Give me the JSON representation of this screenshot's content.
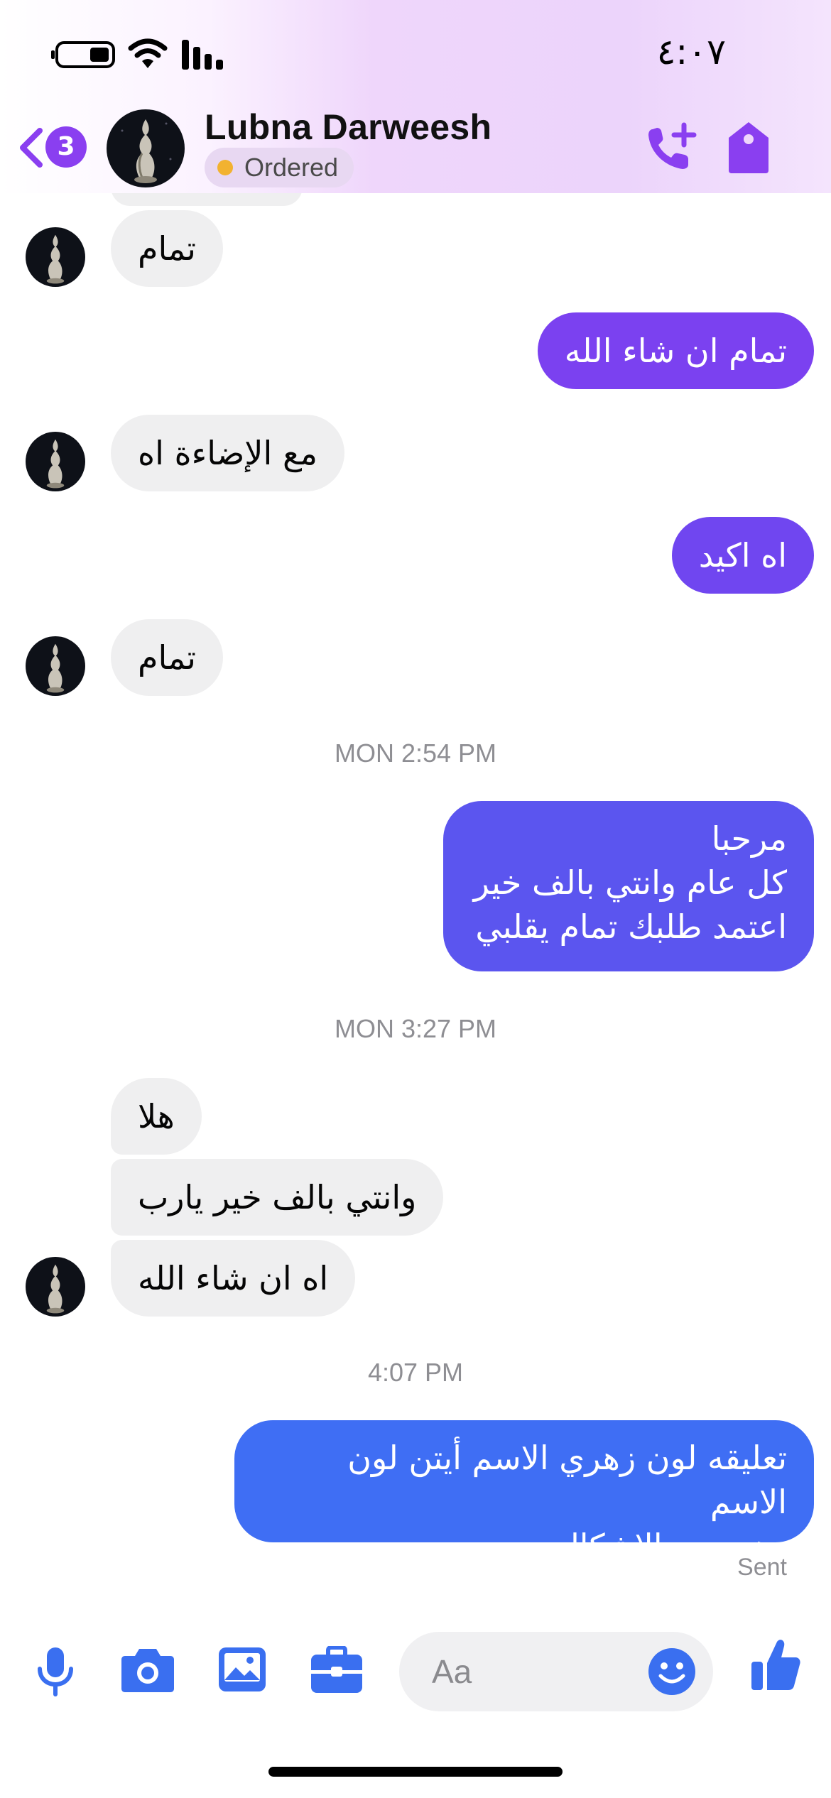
{
  "status_bar": {
    "time": "٤:٠٧",
    "icons": [
      "battery-icon",
      "wifi-icon",
      "signal-icon"
    ]
  },
  "header": {
    "unread_count": "3",
    "contact_name": "Lubna Darweesh",
    "order_status": "Ordered",
    "icons": [
      "back-chevron-icon",
      "add-call-icon",
      "tag-icon"
    ]
  },
  "colors": {
    "accent": "#7b3ff2",
    "incoming_bubble": "#efeff0",
    "outgoing_purple": "#7b41f0",
    "outgoing_indigo": "#5b55ef",
    "outgoing_blue": "#3f6ef4",
    "icon_blue": "#3a6ff0",
    "status_dot": "#f2b230"
  },
  "messages": {
    "m1": "تمام",
    "m2": "تمام ان شاء الله",
    "m3": "مع الإضاءة اه",
    "m4": "اه اكيد",
    "m5": "تمام",
    "ts1": "MON 2:54 PM",
    "m6": "مرحبا\nكل عام وانتي بالف خير\nاعتمد طلبك تمام يقلبي",
    "ts2": "MON 3:27 PM",
    "m7": "هلا",
    "m8": "وانتي بالف خير يارب",
    "m9": "اه ان شاء الله",
    "ts3": "4:07 PM",
    "m10": "تعليقه لون زهري الاسم أيتن لون الاسم\nدهبي مع الاشكال",
    "sent": "Sent"
  },
  "composer": {
    "placeholder": "Aa",
    "icons": [
      "microphone-icon",
      "camera-icon",
      "gallery-icon",
      "briefcase-icon",
      "emoji-icon",
      "like-icon"
    ]
  }
}
